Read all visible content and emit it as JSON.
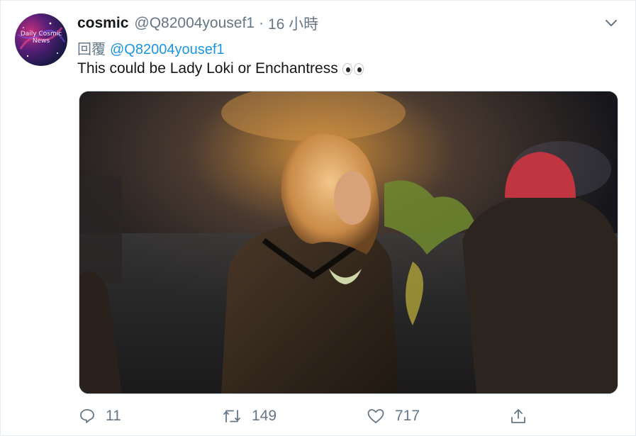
{
  "author": {
    "name": "cosmic",
    "handle": "@Q82004yousef1",
    "separator": "·",
    "time": "16 小時",
    "avatar_text": "Daily Cosmic News"
  },
  "reply": {
    "prefix": "回覆",
    "mention": "@Q82004yousef1"
  },
  "tweet": {
    "text": "This could be Lady Loki or Enchantress",
    "emoji": "eyes"
  },
  "menu": {
    "icon": "chevron-down-icon"
  },
  "actions": {
    "reply": {
      "icon": "reply-icon",
      "count": "11"
    },
    "retweet": {
      "icon": "retweet-icon",
      "count": "149"
    },
    "like": {
      "icon": "heart-icon",
      "count": "717"
    },
    "share": {
      "icon": "share-icon"
    }
  },
  "colors": {
    "text": "#14171a",
    "secondary": "#657786",
    "link": "#1b95e0",
    "border": "#e6ecf0"
  }
}
